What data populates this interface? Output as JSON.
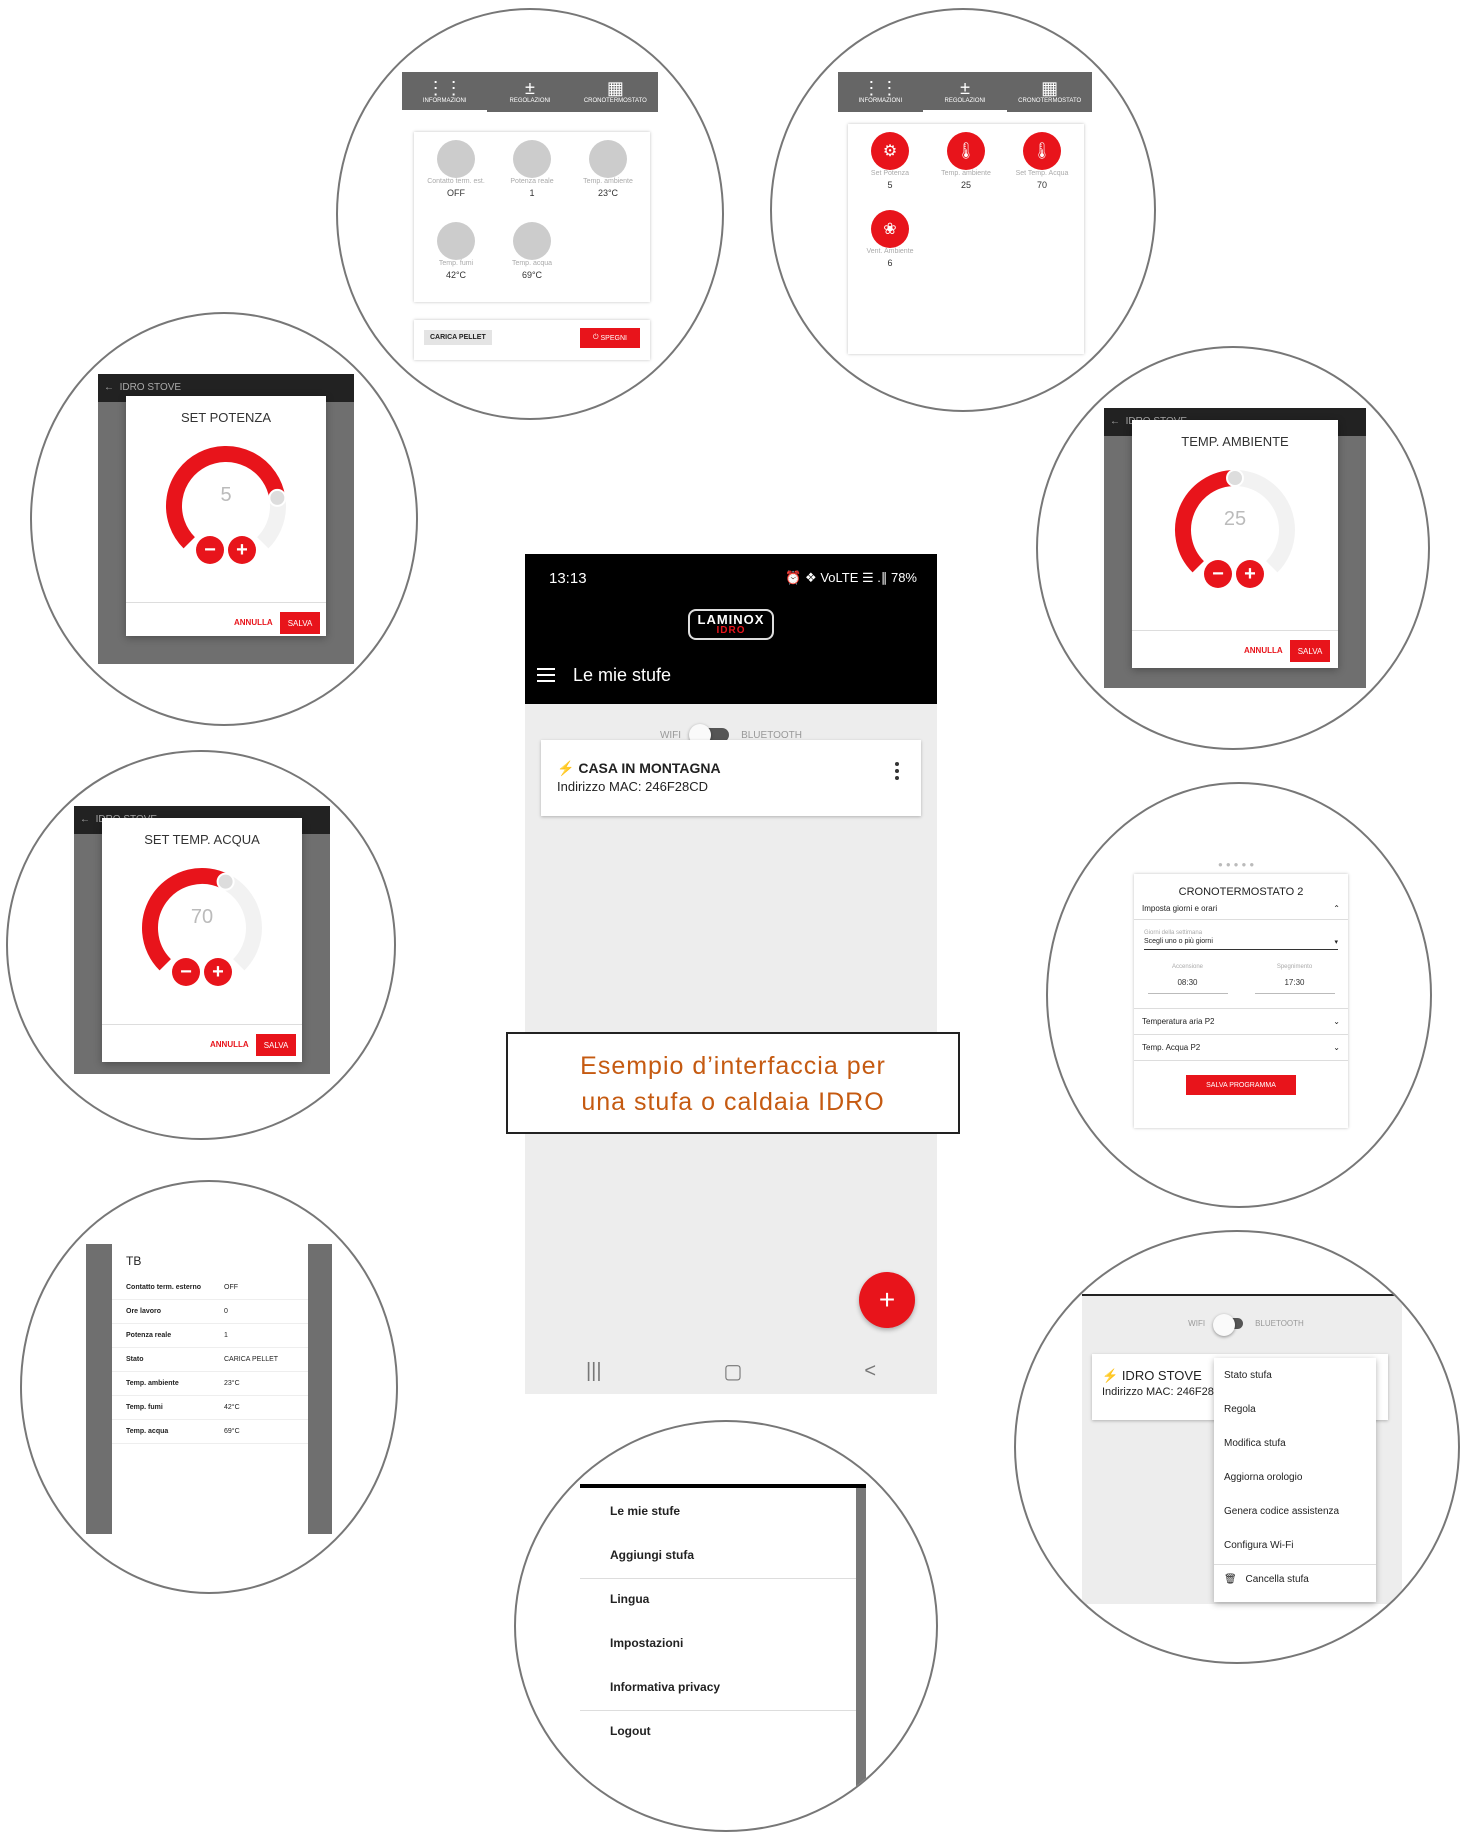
{
  "phone": {
    "time": "13:13",
    "status_icons": "⏰ ❖ VoLTE ☰ .∥ 78%",
    "logo_line1": "LAMINOX",
    "logo_line2": "IDRO",
    "title": "Le mie stufe",
    "toggle_left": "WIFI",
    "toggle_right": "BLUETOOTH",
    "stove_name": "CASA IN MONTAGNA",
    "stove_mac": "Indirizzo MAC: 246F28CD",
    "fab_label": "+",
    "nav_recent": "|||",
    "nav_home": "▢",
    "nav_back": "<"
  },
  "caption": {
    "line1": "Esempio d’interfaccia per",
    "line2": "una stufa o caldaia IDRO"
  },
  "info_screen": {
    "tabs": [
      "INFORMAZIONI",
      "REGOLAZIONI",
      "CRONOTERMOSTATO"
    ],
    "items": [
      {
        "label": "Contatto term. est.",
        "value": "OFF"
      },
      {
        "label": "Potenza reale",
        "value": "1"
      },
      {
        "label": "Temp. ambiente",
        "value": "23°C"
      },
      {
        "label": "Temp. fumi",
        "value": "42°C"
      },
      {
        "label": "Temp. acqua",
        "value": "69°C"
      }
    ],
    "carica": "CARICA PELLET",
    "spegni": "SPEGNI"
  },
  "reg_screen": {
    "tabs": [
      "INFORMAZIONI",
      "REGOLAZIONI",
      "CRONOTERMOSTATO"
    ],
    "items": [
      {
        "label": "Set Potenza",
        "value": "5"
      },
      {
        "label": "Temp. ambiente",
        "value": "25"
      },
      {
        "label": "Set Temp. Acqua",
        "value": "70"
      },
      {
        "label": "Vent. Ambiente",
        "value": "6"
      }
    ]
  },
  "dialog_potenza": {
    "header": "IDRO STOVE",
    "title": "SET POTENZA",
    "value": "5",
    "level": 0.8,
    "cancel": "ANNULLA",
    "save": "SALVA"
  },
  "dialog_ambiente": {
    "header": "IDRO STOVE",
    "title": "TEMP. AMBIENTE",
    "value": "25",
    "level": 0.5,
    "cancel": "ANNULLA",
    "save": "SALVA"
  },
  "dialog_acqua": {
    "header": "IDRO STOVE",
    "title": "SET TEMP. ACQUA",
    "value": "70",
    "level": 0.6,
    "cancel": "ANNULLA",
    "save": "SALVA"
  },
  "crono": {
    "title": "CRONOTERMOSTATO 2",
    "section": "Imposta giorni e orari",
    "days_label": "Giorni della settimana",
    "days_value": "Scegli uno o più giorni",
    "on_label": "Accensione",
    "on_value": "08:30",
    "off_label": "Spegnimento",
    "off_value": "17:30",
    "row1": "Temperatura aria P2",
    "row2": "Temp. Acqua P2",
    "save": "SALVA PROGRAMMA"
  },
  "tb": {
    "title": "TB",
    "rows": [
      {
        "k": "Contatto term. esterno",
        "v": "OFF"
      },
      {
        "k": "Ore lavoro",
        "v": "0"
      },
      {
        "k": "Potenza reale",
        "v": "1"
      },
      {
        "k": "Stato",
        "v": "CARICA PELLET"
      },
      {
        "k": "Temp. ambiente",
        "v": "23°C"
      },
      {
        "k": "Temp. fumi",
        "v": "42°C"
      },
      {
        "k": "Temp. acqua",
        "v": "69°C"
      }
    ]
  },
  "drawer": {
    "items": [
      "Le mie stufe",
      "Aggiungi stufa",
      "Lingua",
      "Impostazioni",
      "Informativa privacy",
      "Logout"
    ]
  },
  "context": {
    "toggle_left": "WIFI",
    "toggle_right": "BLUETOOTH",
    "stove": "IDRO STOVE",
    "mac": "Indirizzo MAC: 246F28C",
    "menu": [
      "Stato stufa",
      "Regola",
      "Modifica stufa",
      "Aggiorna orologio",
      "Genera codice assistenza",
      "Configura Wi-Fi",
      "Cancella stufa"
    ]
  }
}
